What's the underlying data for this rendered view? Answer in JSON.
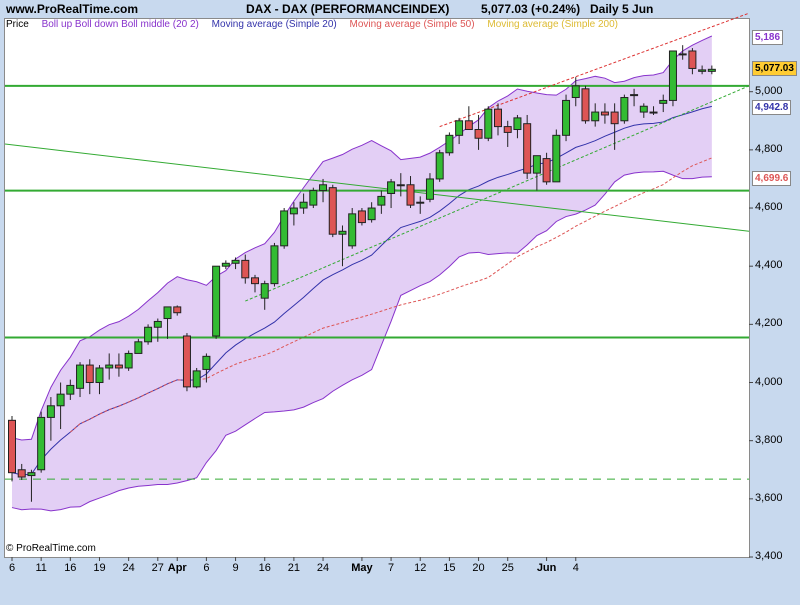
{
  "header": {
    "site": "www.ProRealTime.com",
    "instrument": "DAX - DAX (PERFORMANCEINDEX)",
    "last": "5,077.03 (+0.24%)",
    "period": "Daily 5 Jun"
  },
  "legend": {
    "price": "Price",
    "boll": "Boll up Boll down Boll middle (20 2)",
    "ma20": "Moving average (Simple 20)",
    "ma50": "Moving average (Simple 50)",
    "ma200": "Moving average (Simple 200)"
  },
  "copyright": "© ProRealTime.com",
  "colors": {
    "up": "#33bb33",
    "down": "#dd5555",
    "band_fill": "#e3cff5",
    "band_line": "#8833cc",
    "ma20": "#3333aa",
    "ma50": "#dd5555",
    "ma200": "#33aa33",
    "hline": "#33aa33",
    "channel": "#dd3333",
    "last_box": "#ffcc33"
  },
  "chart_data": {
    "type": "candlestick",
    "ylim": [
      3400,
      5250
    ],
    "yticks": [
      3400,
      3600,
      3800,
      4000,
      4200,
      4400,
      4600,
      4800,
      5000
    ],
    "xtick_labels": [
      "6",
      "11",
      "16",
      "19",
      "24",
      "27",
      "Apr",
      "6",
      "9",
      "16",
      "21",
      "24",
      "May",
      "7",
      "12",
      "15",
      "20",
      "25",
      "Jun",
      "4"
    ],
    "xtick_index": [
      0,
      3,
      6,
      9,
      12,
      15,
      17,
      20,
      23,
      26,
      29,
      32,
      36,
      39,
      42,
      45,
      48,
      51,
      55,
      58
    ],
    "price_labels": [
      {
        "label": "5,186",
        "value": 5186,
        "kind": "boll"
      },
      {
        "label": "5,077.03",
        "value": 5077.03,
        "kind": "last"
      },
      {
        "label": "4,942.8",
        "value": 4942.8,
        "kind": "ma20"
      },
      {
        "label": "4,699.6",
        "value": 4699.6,
        "kind": "ma50"
      }
    ],
    "horizontal_lines": [
      5020,
      4660,
      4155
    ],
    "dashed_line": 3668,
    "ohlc": [
      [
        3870,
        3885,
        3660,
        3690
      ],
      [
        3700,
        3720,
        3665,
        3675
      ],
      [
        3680,
        3700,
        3590,
        3690
      ],
      [
        3700,
        3900,
        3690,
        3880
      ],
      [
        3880,
        3950,
        3800,
        3920
      ],
      [
        3920,
        4000,
        3840,
        3960
      ],
      [
        3960,
        4010,
        3940,
        3990
      ],
      [
        3980,
        4070,
        3950,
        4060
      ],
      [
        4060,
        4080,
        3960,
        4000
      ],
      [
        4000,
        4060,
        3960,
        4050
      ],
      [
        4050,
        4100,
        4010,
        4060
      ],
      [
        4060,
        4100,
        4020,
        4050
      ],
      [
        4050,
        4110,
        4040,
        4100
      ],
      [
        4100,
        4150,
        4100,
        4140
      ],
      [
        4140,
        4200,
        4130,
        4190
      ],
      [
        4190,
        4220,
        4140,
        4210
      ],
      [
        4220,
        4260,
        4150,
        4260
      ],
      [
        4260,
        4265,
        4230,
        4240
      ],
      [
        4160,
        4170,
        3970,
        3985
      ],
      [
        3985,
        4050,
        3980,
        4040
      ],
      [
        4045,
        4100,
        4000,
        4090
      ],
      [
        4160,
        4400,
        4150,
        4400
      ],
      [
        4400,
        4420,
        4390,
        4410
      ],
      [
        4410,
        4430,
        4390,
        4420
      ],
      [
        4420,
        4440,
        4340,
        4360
      ],
      [
        4360,
        4370,
        4310,
        4340
      ],
      [
        4290,
        4350,
        4250,
        4340
      ],
      [
        4340,
        4480,
        4330,
        4470
      ],
      [
        4470,
        4600,
        4460,
        4590
      ],
      [
        4580,
        4620,
        4540,
        4600
      ],
      [
        4600,
        4650,
        4580,
        4620
      ],
      [
        4610,
        4670,
        4600,
        4660
      ],
      [
        4660,
        4700,
        4620,
        4680
      ],
      [
        4670,
        4680,
        4500,
        4510
      ],
      [
        4510,
        4540,
        4400,
        4520
      ],
      [
        4470,
        4600,
        4460,
        4580
      ],
      [
        4590,
        4600,
        4540,
        4550
      ],
      [
        4560,
        4620,
        4550,
        4600
      ],
      [
        4610,
        4660,
        4580,
        4640
      ],
      [
        4650,
        4700,
        4600,
        4690
      ],
      [
        4680,
        4720,
        4640,
        4680
      ],
      [
        4680,
        4710,
        4600,
        4610
      ],
      [
        4620,
        4640,
        4580,
        4620
      ],
      [
        4630,
        4720,
        4620,
        4700
      ],
      [
        4700,
        4800,
        4690,
        4790
      ],
      [
        4790,
        4860,
        4780,
        4850
      ],
      [
        4850,
        4910,
        4820,
        4900
      ],
      [
        4900,
        4950,
        4870,
        4870
      ],
      [
        4870,
        4920,
        4800,
        4840
      ],
      [
        4840,
        4950,
        4830,
        4940
      ],
      [
        4940,
        4960,
        4850,
        4880
      ],
      [
        4880,
        4900,
        4810,
        4860
      ],
      [
        4870,
        4920,
        4840,
        4910
      ],
      [
        4890,
        4920,
        4700,
        4720
      ],
      [
        4720,
        4780,
        4660,
        4780
      ],
      [
        4770,
        4790,
        4680,
        4690
      ],
      [
        4690,
        4870,
        4690,
        4850
      ],
      [
        4850,
        4990,
        4830,
        4970
      ],
      [
        4980,
        5050,
        4950,
        5020
      ],
      [
        5010,
        5020,
        4890,
        4900
      ],
      [
        4900,
        4960,
        4880,
        4930
      ],
      [
        4930,
        4960,
        4890,
        4920
      ],
      [
        4930,
        4960,
        4800,
        4890
      ],
      [
        4900,
        4990,
        4890,
        4980
      ],
      [
        4990,
        5010,
        4950,
        4990
      ],
      [
        4930,
        4960,
        4910,
        4950
      ],
      [
        4930,
        4950,
        4920,
        4930
      ],
      [
        4960,
        4990,
        4930,
        4970
      ],
      [
        4970,
        5140,
        4950,
        5140
      ],
      [
        5130,
        5160,
        5110,
        5130
      ],
      [
        5140,
        5150,
        5060,
        5080
      ],
      [
        5070,
        5090,
        5060,
        5075
      ],
      [
        5070,
        5090,
        5060,
        5077
      ]
    ]
  }
}
